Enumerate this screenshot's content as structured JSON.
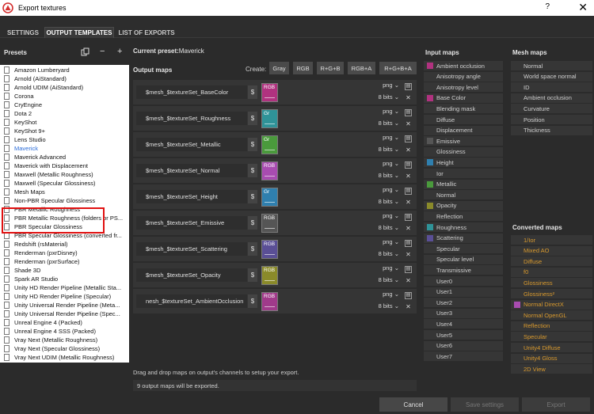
{
  "window": {
    "title": "Export textures",
    "help": "?",
    "close": "✕"
  },
  "tabs": [
    {
      "label": "SETTINGS"
    },
    {
      "label": "OUTPUT TEMPLATES"
    },
    {
      "label": "LIST OF EXPORTS"
    }
  ],
  "presets": {
    "title": "Presets",
    "items": [
      "Amazon Lumberyard",
      "Arnold (AiStandard)",
      "Arnold UDIM (AiStandard)",
      "Corona",
      "CryEngine",
      "Dota 2",
      "KeyShot",
      "KeyShot 9+",
      "Lens Studio",
      "Maverick",
      "Maverick Advanced",
      "Maverick with Displacement",
      "Maxwell (Metallic Roughness)",
      "Maxwell (Specular Glossiness)",
      "Mesh Maps",
      "Non-PBR Specular Glossiness",
      "PBR Metallic Roughness",
      "PBR Metallic Roughness (folders or PS...",
      "PBR Specular Glossiness",
      "PBR Specular Glossiness (converted fr...",
      "Redshift (rsMaterial)",
      "Renderman (pxrDisney)",
      "Renderman (pxrSurface)",
      "Shade 3D",
      "Spark AR Studio",
      "Unity HD Render Pipeline (Metallic Sta...",
      "Unity HD Render Pipeline (Specular)",
      "Unity Universal Render Pipeline (Meta...",
      "Unity Universal Render Pipeline (Spec...",
      "Unreal Engine 4 (Packed)",
      "Unreal Engine 4 SSS (Packed)",
      "Vray Next (Metallic Roughness)",
      "Vray Next (Specular Glossiness)",
      "Vray Next UDIM (Metallic Roughness)"
    ],
    "selected": "Maverick"
  },
  "current_preset": {
    "label": "Current preset:",
    "value": "Maverick"
  },
  "output_maps": {
    "title": "Output maps",
    "create_label": "Create:",
    "create_buttons": [
      "Gray",
      "RGB",
      "R+G+B",
      "RGB+A",
      "R+G+B+A"
    ],
    "rows": [
      {
        "name": "$mesh_$textureSet_BaseColor",
        "channel": "RGB",
        "color": "#b0327f",
        "format": "png",
        "bits": "8 bits"
      },
      {
        "name": "$mesh_$textureSet_Roughness",
        "channel": "Gr",
        "color": "#2f9398",
        "format": "png",
        "bits": "8 bits"
      },
      {
        "name": "$mesh_$textureSet_Metallic",
        "channel": "Gr",
        "color": "#4a9a3c",
        "format": "png",
        "bits": "8 bits"
      },
      {
        "name": "$mesh_$textureSet_Normal",
        "channel": "RGB",
        "color": "#a84cb0",
        "format": "png",
        "bits": "8 bits"
      },
      {
        "name": "$mesh_$textureSet_Height",
        "channel": "Gr",
        "color": "#2f7fae",
        "format": "png",
        "bits": "8 bits"
      },
      {
        "name": "$mesh_$textureSet_Emissive",
        "channel": "RGB",
        "color": "#555555",
        "format": "png",
        "bits": "8 bits"
      },
      {
        "name": "$mesh_$textureSet_Scattering",
        "channel": "RGB",
        "color": "#5a4f96",
        "format": "png",
        "bits": "8 bits"
      },
      {
        "name": "$mesh_$textureSet_Opacity",
        "channel": "RGB",
        "color": "#8a8a2a",
        "format": "png",
        "bits": "8 bits"
      },
      {
        "name": "nesh_$textureSet_AmbientOcclusion",
        "channel": "RGB",
        "color": "#a03a8a",
        "format": "png",
        "bits": "8 bits"
      }
    ],
    "dollar": "$",
    "hint": "Drag and drop maps on output's channels to setup your export.",
    "status": "9 output maps will be exported."
  },
  "input_maps": {
    "title": "Input maps",
    "items": [
      {
        "label": "Ambient occlusion",
        "color": "#b0327f"
      },
      {
        "label": "Anisotropy angle",
        "color": ""
      },
      {
        "label": "Anisotropy level",
        "color": ""
      },
      {
        "label": "Base Color",
        "color": "#b0327f"
      },
      {
        "label": "Blending mask",
        "color": ""
      },
      {
        "label": "Diffuse",
        "color": ""
      },
      {
        "label": "Displacement",
        "color": ""
      },
      {
        "label": "Emissive",
        "color": "#555555"
      },
      {
        "label": "Glossiness",
        "color": ""
      },
      {
        "label": "Height",
        "color": "#2f7fae"
      },
      {
        "label": "Ior",
        "color": ""
      },
      {
        "label": "Metallic",
        "color": "#4a9a3c"
      },
      {
        "label": "Normal",
        "color": ""
      },
      {
        "label": "Opacity",
        "color": "#8a8a2a"
      },
      {
        "label": "Reflection",
        "color": ""
      },
      {
        "label": "Roughness",
        "color": "#2f9398"
      },
      {
        "label": "Scattering",
        "color": "#5a4f96"
      },
      {
        "label": "Specular",
        "color": ""
      },
      {
        "label": "Specular level",
        "color": ""
      },
      {
        "label": "Transmissive",
        "color": ""
      },
      {
        "label": "User0",
        "color": ""
      },
      {
        "label": "User1",
        "color": ""
      },
      {
        "label": "User2",
        "color": ""
      },
      {
        "label": "User3",
        "color": ""
      },
      {
        "label": "User4",
        "color": ""
      },
      {
        "label": "User5",
        "color": ""
      },
      {
        "label": "User6",
        "color": ""
      },
      {
        "label": "User7",
        "color": ""
      }
    ]
  },
  "mesh_maps": {
    "title": "Mesh maps",
    "items": [
      "Normal",
      "World space normal",
      "ID",
      "Ambient occlusion",
      "Curvature",
      "Position",
      "Thickness"
    ]
  },
  "converted_maps": {
    "title": "Converted maps",
    "items": [
      {
        "label": "1/Ior",
        "color": ""
      },
      {
        "label": "Mixed AO",
        "color": ""
      },
      {
        "label": "Diffuse",
        "color": ""
      },
      {
        "label": "f0",
        "color": ""
      },
      {
        "label": "Glossiness",
        "color": ""
      },
      {
        "label": "Glossiness²",
        "color": ""
      },
      {
        "label": "Normal DirectX",
        "color": "#a84cb0"
      },
      {
        "label": "Normal OpenGL",
        "color": ""
      },
      {
        "label": "Reflection",
        "color": ""
      },
      {
        "label": "Specular",
        "color": ""
      },
      {
        "label": "Unity4 Diffuse",
        "color": ""
      },
      {
        "label": "Unity4 Gloss",
        "color": ""
      },
      {
        "label": "2D View",
        "color": ""
      }
    ]
  },
  "footer": {
    "cancel": "Cancel",
    "save": "Save settings",
    "export": "Export"
  }
}
